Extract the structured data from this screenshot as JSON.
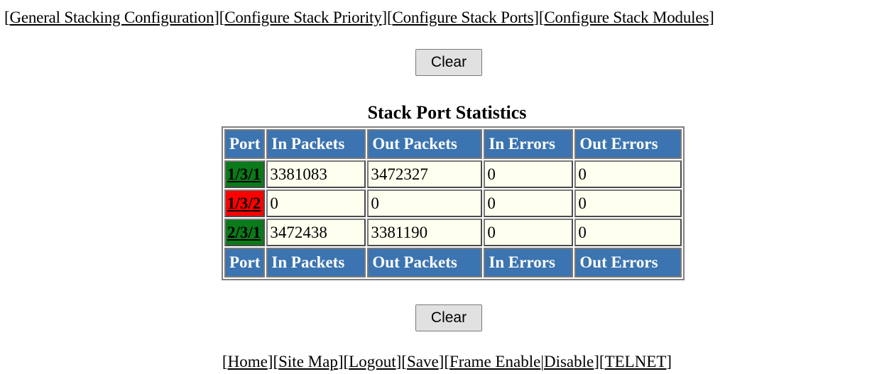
{
  "top_nav": [
    "General Stacking Configuration",
    "Configure Stack Priority",
    "Configure Stack Ports",
    "Configure Stack Modules"
  ],
  "buttons": {
    "clear_top": "Clear",
    "clear_bottom": "Clear"
  },
  "table": {
    "title": "Stack Port Statistics",
    "headers": [
      "Port",
      "In Packets",
      "Out Packets",
      "In Errors",
      "Out Errors"
    ],
    "rows": [
      {
        "port": "1/3/1",
        "status_color": "#0a7a1a",
        "in_packets": "3381083",
        "out_packets": "3472327",
        "in_errors": "0",
        "out_errors": "0"
      },
      {
        "port": "1/3/2",
        "status_color": "#ff0000",
        "in_packets": "0",
        "out_packets": "0",
        "in_errors": "0",
        "out_errors": "0"
      },
      {
        "port": "2/3/1",
        "status_color": "#0a7a1a",
        "in_packets": "3472438",
        "out_packets": "3381190",
        "in_errors": "0",
        "out_errors": "0"
      }
    ]
  },
  "bottom_nav": {
    "home": "Home",
    "site_map": "Site Map",
    "logout": "Logout",
    "save": "Save",
    "frame_enable": "Frame Enable",
    "disable": "Disable",
    "telnet": "TELNET"
  },
  "colors": {
    "header_bg": "#3b74b0",
    "cell_bg": "#fffff0",
    "port_up": "#0a7a1a",
    "port_down": "#ff0000"
  }
}
